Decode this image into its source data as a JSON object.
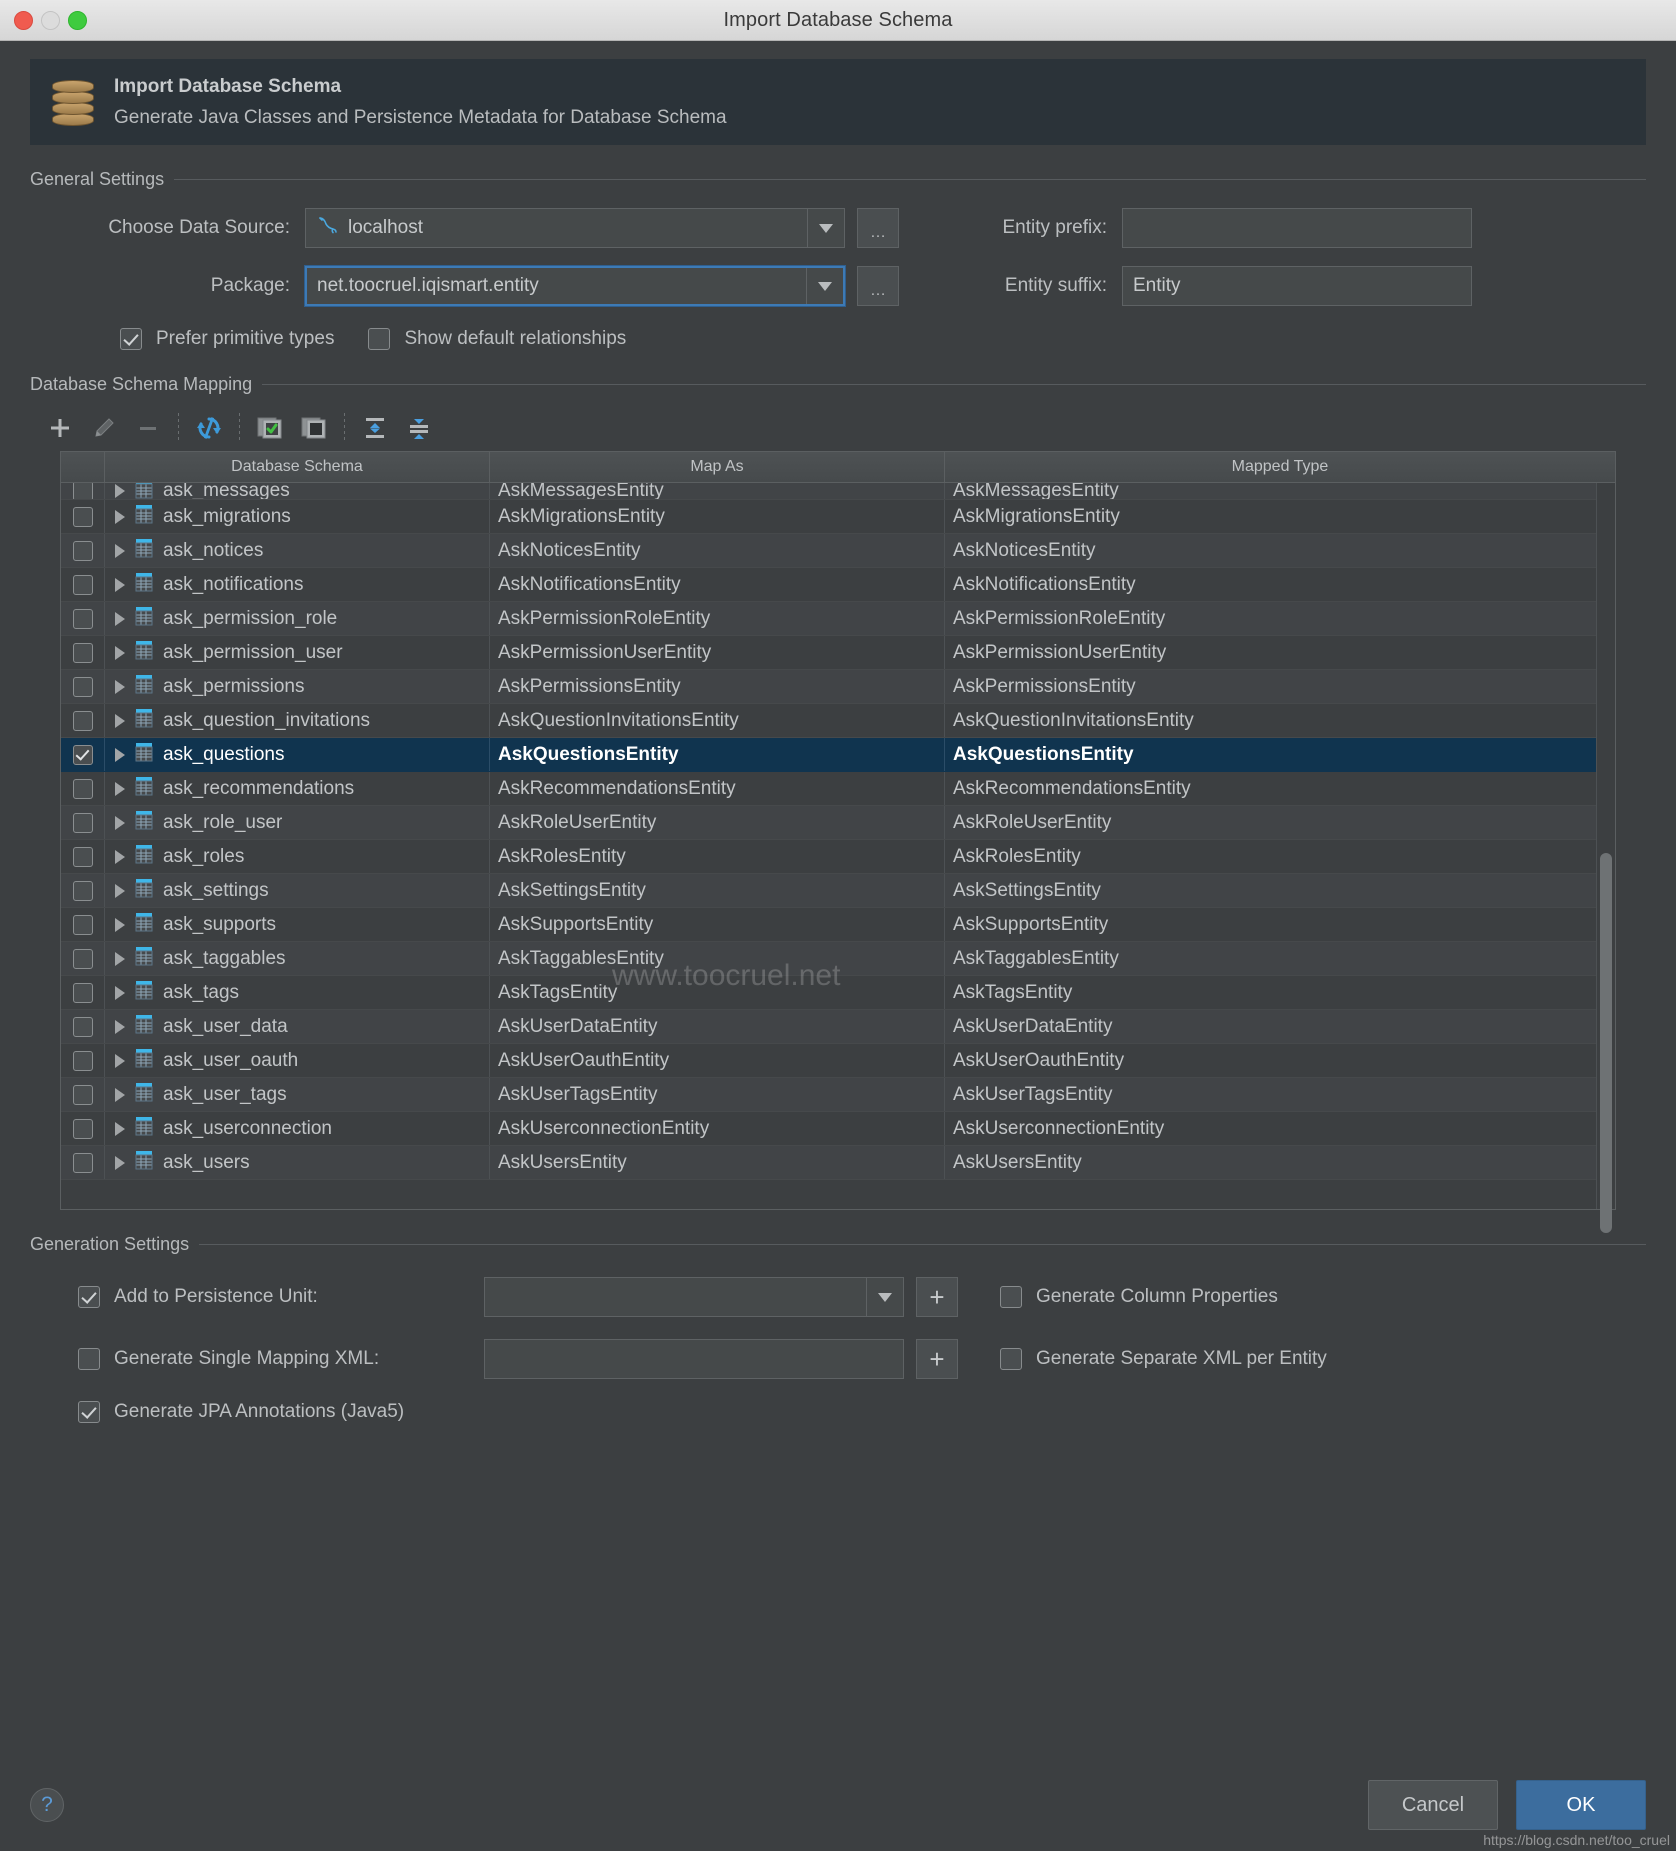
{
  "window": {
    "title": "Import Database Schema",
    "traffic_lights": [
      "close-button",
      "minimize-button",
      "zoom-button"
    ]
  },
  "banner": {
    "icon": "database-import-icon",
    "title": "Import Database Schema",
    "subtitle": "Generate Java Classes and Persistence Metadata for Database Schema"
  },
  "general_settings": {
    "group_title": "General Settings",
    "data_source": {
      "label": "Choose Data Source:",
      "value": "localhost",
      "icon": "mysql-dolphin-icon",
      "browse_label": "…"
    },
    "package": {
      "label": "Package:",
      "value": "net.toocruel.iqismart.entity",
      "browse_label": "…",
      "focused": true
    },
    "entity_prefix": {
      "label": "Entity prefix:",
      "value": ""
    },
    "entity_suffix": {
      "label": "Entity suffix:",
      "value": "Entity"
    },
    "prefer_primitive_types": {
      "label": "Prefer primitive types",
      "checked": true
    },
    "show_default_relationships": {
      "label": "Show default relationships",
      "checked": false
    }
  },
  "schema_mapping": {
    "group_title": "Database Schema Mapping",
    "toolbar": [
      {
        "name": "add-button",
        "icon": "plus-icon"
      },
      {
        "name": "edit-button",
        "icon": "pencil-icon"
      },
      {
        "name": "remove-button",
        "icon": "minus-icon"
      },
      {
        "name": "refresh-button",
        "icon": "refresh-icon"
      },
      {
        "name": "select-all-button",
        "icon": "checked-squares-icon"
      },
      {
        "name": "deselect-all-button",
        "icon": "unchecked-squares-icon"
      },
      {
        "name": "expand-all-button",
        "icon": "expand-all-icon"
      },
      {
        "name": "collapse-all-button",
        "icon": "collapse-all-icon"
      }
    ],
    "columns": [
      "Database Schema",
      "Map As",
      "Mapped Type"
    ],
    "rows": [
      {
        "schema": "ask_messages",
        "map_as": "AskMessagesEntity",
        "mapped_type": "AskMessagesEntity",
        "checked": false,
        "clipped": true
      },
      {
        "schema": "ask_migrations",
        "map_as": "AskMigrationsEntity",
        "mapped_type": "AskMigrationsEntity",
        "checked": false
      },
      {
        "schema": "ask_notices",
        "map_as": "AskNoticesEntity",
        "mapped_type": "AskNoticesEntity",
        "checked": false
      },
      {
        "schema": "ask_notifications",
        "map_as": "AskNotificationsEntity",
        "mapped_type": "AskNotificationsEntity",
        "checked": false
      },
      {
        "schema": "ask_permission_role",
        "map_as": "AskPermissionRoleEntity",
        "mapped_type": "AskPermissionRoleEntity",
        "checked": false
      },
      {
        "schema": "ask_permission_user",
        "map_as": "AskPermissionUserEntity",
        "mapped_type": "AskPermissionUserEntity",
        "checked": false
      },
      {
        "schema": "ask_permissions",
        "map_as": "AskPermissionsEntity",
        "mapped_type": "AskPermissionsEntity",
        "checked": false
      },
      {
        "schema": "ask_question_invitations",
        "map_as": "AskQuestionInvitationsEntity",
        "mapped_type": "AskQuestionInvitationsEntity",
        "checked": false
      },
      {
        "schema": "ask_questions",
        "map_as": "AskQuestionsEntity",
        "mapped_type": "AskQuestionsEntity",
        "checked": true,
        "selected": true
      },
      {
        "schema": "ask_recommendations",
        "map_as": "AskRecommendationsEntity",
        "mapped_type": "AskRecommendationsEntity",
        "checked": false
      },
      {
        "schema": "ask_role_user",
        "map_as": "AskRoleUserEntity",
        "mapped_type": "AskRoleUserEntity",
        "checked": false
      },
      {
        "schema": "ask_roles",
        "map_as": "AskRolesEntity",
        "mapped_type": "AskRolesEntity",
        "checked": false
      },
      {
        "schema": "ask_settings",
        "map_as": "AskSettingsEntity",
        "mapped_type": "AskSettingsEntity",
        "checked": false
      },
      {
        "schema": "ask_supports",
        "map_as": "AskSupportsEntity",
        "mapped_type": "AskSupportsEntity",
        "checked": false
      },
      {
        "schema": "ask_taggables",
        "map_as": "AskTaggablesEntity",
        "mapped_type": "AskTaggablesEntity",
        "checked": false
      },
      {
        "schema": "ask_tags",
        "map_as": "AskTagsEntity",
        "mapped_type": "AskTagsEntity",
        "checked": false
      },
      {
        "schema": "ask_user_data",
        "map_as": "AskUserDataEntity",
        "mapped_type": "AskUserDataEntity",
        "checked": false
      },
      {
        "schema": "ask_user_oauth",
        "map_as": "AskUserOauthEntity",
        "mapped_type": "AskUserOauthEntity",
        "checked": false
      },
      {
        "schema": "ask_user_tags",
        "map_as": "AskUserTagsEntity",
        "mapped_type": "AskUserTagsEntity",
        "checked": false
      },
      {
        "schema": "ask_userconnection",
        "map_as": "AskUserconnectionEntity",
        "mapped_type": "AskUserconnectionEntity",
        "checked": false
      },
      {
        "schema": "ask_users",
        "map_as": "AskUsersEntity",
        "mapped_type": "AskUsersEntity",
        "checked": false
      }
    ]
  },
  "generation_settings": {
    "group_title": "Generation Settings",
    "add_to_persistence_unit": {
      "label": "Add to Persistence Unit:",
      "checked": true,
      "value": "",
      "add_label": "+"
    },
    "generate_single_mapping_xml": {
      "label": "Generate Single Mapping XML:",
      "checked": false,
      "value": "",
      "add_label": "+"
    },
    "generate_jpa_annotations": {
      "label": "Generate JPA Annotations (Java5)",
      "checked": true
    },
    "generate_column_properties": {
      "label": "Generate Column Properties",
      "checked": false
    },
    "generate_separate_xml_per_entity": {
      "label": "Generate Separate XML per Entity",
      "checked": false
    }
  },
  "footer": {
    "help_label": "?",
    "cancel_label": "Cancel",
    "ok_label": "OK"
  },
  "watermarks": {
    "center": "www.toocruel.net",
    "bottom_right": "https://blog.csdn.net/too_cruel"
  },
  "colors": {
    "dialog_bg": "#3c3f41",
    "banner_bg": "#2b3339",
    "selection": "#10344f",
    "accent_blue": "#3c6d9e",
    "table_icon_header": "#3fb6e8"
  }
}
